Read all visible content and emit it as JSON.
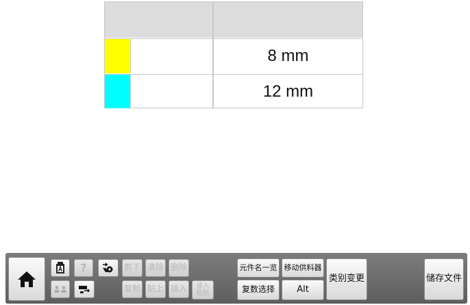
{
  "table": {
    "rows": [
      {
        "color": "#ffff00",
        "size": "8 mm"
      },
      {
        "color": "#00ffff",
        "size": "12 mm"
      }
    ]
  },
  "toolbar": {
    "help": "?",
    "cut": "剪下",
    "clear": "清除",
    "delete": "删除",
    "copy": "复制",
    "paste": "贴上",
    "insert": "插入",
    "insert_paste_line1": "插入",
    "insert_paste_line2": "粘贴",
    "part_name_list": "元件名一览",
    "move_feeder": "移动供料器",
    "multi_select": "复数选择",
    "alt": "Alt",
    "category_change": "类别变更",
    "save_file": "储存文件"
  },
  "icons": {
    "home": "home-icon",
    "document": "document-a-icon",
    "users": "users-icon",
    "device": "device-icon",
    "gear_arrow": "gear-arrow-icon"
  }
}
